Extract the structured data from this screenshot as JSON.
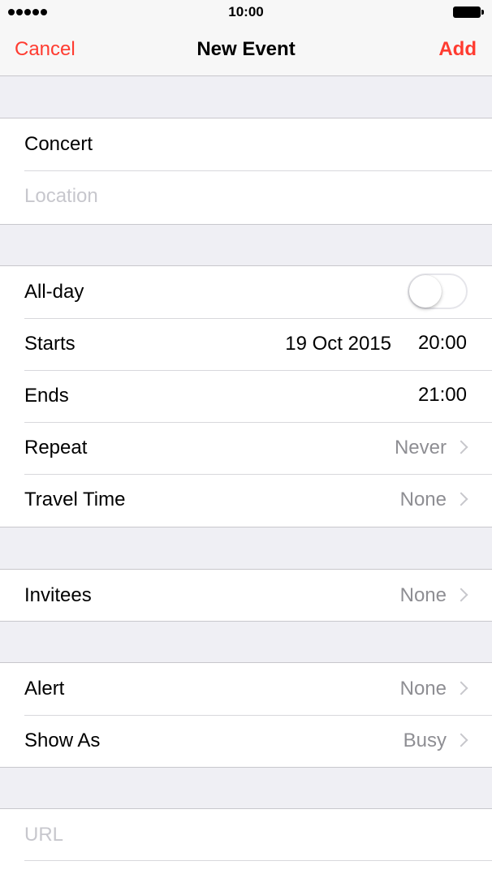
{
  "status_bar": {
    "time": "10:00"
  },
  "nav": {
    "cancel": "Cancel",
    "title": "New Event",
    "add": "Add"
  },
  "event": {
    "title": "Concert",
    "location_placeholder": "Location"
  },
  "schedule": {
    "all_day_label": "All-day",
    "all_day_on": false,
    "starts_label": "Starts",
    "starts_date": "19 Oct 2015",
    "starts_time": "20:00",
    "ends_label": "Ends",
    "ends_time": "21:00",
    "repeat_label": "Repeat",
    "repeat_value": "Never",
    "travel_label": "Travel Time",
    "travel_value": "None"
  },
  "invitees": {
    "label": "Invitees",
    "value": "None"
  },
  "alerts": {
    "alert_label": "Alert",
    "alert_value": "None",
    "show_as_label": "Show As",
    "show_as_value": "Busy"
  },
  "url": {
    "placeholder": "URL"
  },
  "colors": {
    "accent": "#ff3b30",
    "secondary_text": "#8e8e93",
    "placeholder": "#c7c7cd",
    "background": "#efeff4"
  }
}
